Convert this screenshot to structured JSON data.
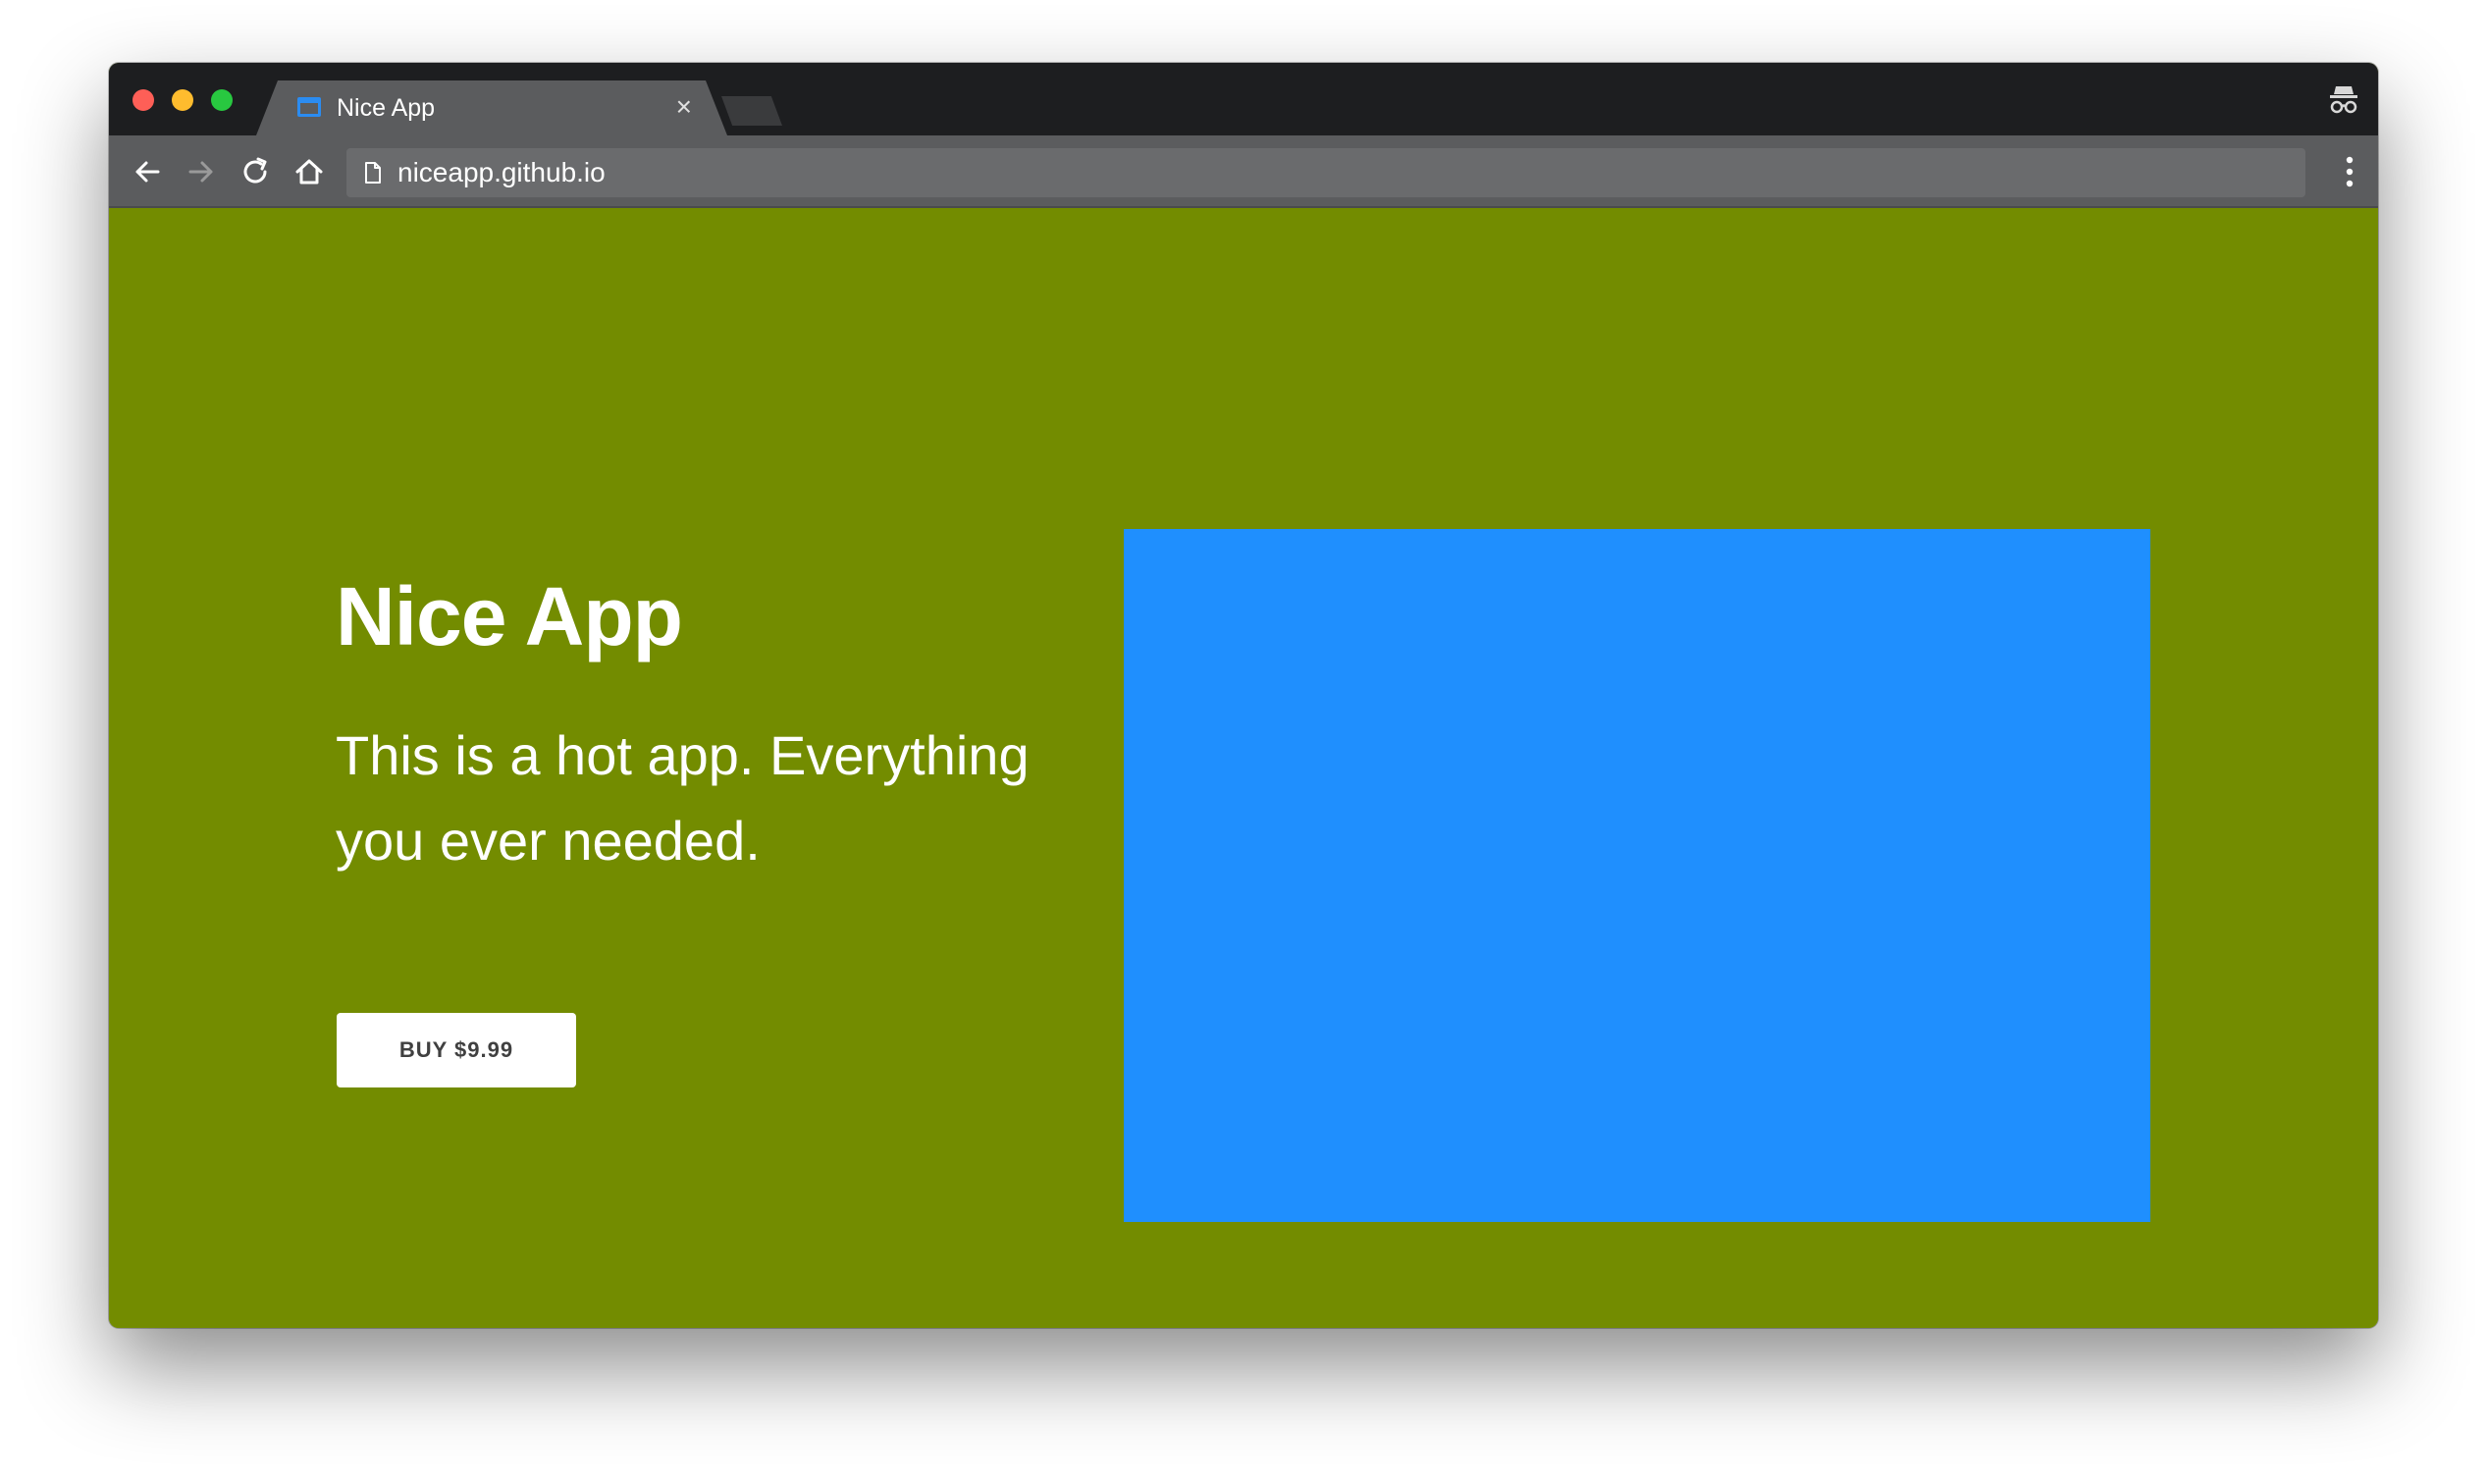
{
  "browser": {
    "tab": {
      "title": "Nice App",
      "close_glyph": "×",
      "favicon": "window-icon"
    },
    "address_bar": {
      "url": "niceapp.github.io",
      "icon": "page-icon"
    },
    "toolbar_icons": [
      "back-arrow-icon",
      "forward-arrow-icon",
      "reload-icon",
      "home-icon",
      "more-vert-icon"
    ],
    "profile_icon": "incognito-icon"
  },
  "page": {
    "title": "Nice App",
    "description": "This is a hot app. Everything you ever needed.",
    "buy_button_label": "BUY $9.99",
    "background_color": "#738c00",
    "image_color": "#1f8ffe"
  }
}
